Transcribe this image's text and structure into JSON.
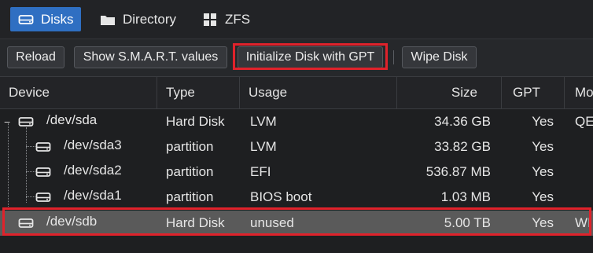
{
  "tabs": [
    {
      "label": "Disks",
      "icon": "disk-icon",
      "active": true
    },
    {
      "label": "Directory",
      "icon": "folder-icon",
      "active": false
    },
    {
      "label": "ZFS",
      "icon": "grid-icon",
      "active": false
    }
  ],
  "toolbar": {
    "reload": "Reload",
    "smart": "Show S.M.A.R.T. values",
    "init_gpt": "Initialize Disk with GPT",
    "wipe": "Wipe Disk"
  },
  "columns": {
    "device": "Device",
    "type": "Type",
    "usage": "Usage",
    "size": "Size",
    "gpt": "GPT",
    "model": "Mo"
  },
  "rows": [
    {
      "device": "/dev/sda",
      "type": "Hard Disk",
      "usage": "LVM",
      "size": "34.36 GB",
      "gpt": "Yes",
      "model": "QE"
    },
    {
      "device": "/dev/sda3",
      "type": "partition",
      "usage": "LVM",
      "size": "33.82 GB",
      "gpt": "Yes",
      "model": ""
    },
    {
      "device": "/dev/sda2",
      "type": "partition",
      "usage": "EFI",
      "size": "536.87 MB",
      "gpt": "Yes",
      "model": ""
    },
    {
      "device": "/dev/sda1",
      "type": "partition",
      "usage": "BIOS boot",
      "size": "1.03 MB",
      "gpt": "Yes",
      "model": ""
    },
    {
      "device": "/dev/sdb",
      "type": "Hard Disk",
      "usage": "unused",
      "size": "5.00 TB",
      "gpt": "Yes",
      "model": "WI"
    }
  ],
  "colors": {
    "accent": "#2f6fc2",
    "highlight": "#e0222b",
    "selected_row": "#5a5a5a"
  }
}
